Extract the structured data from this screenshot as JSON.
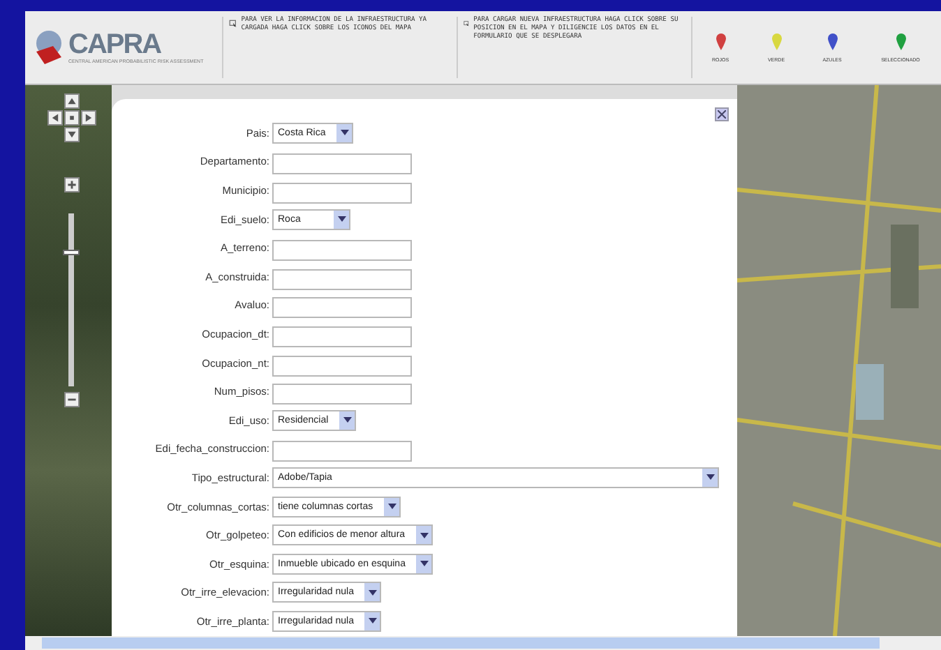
{
  "header": {
    "logo": {
      "name": "CAPRA",
      "subtitle": "CENTRAL AMERICAN PROBABILISTIC RISK ASSESSMENT"
    },
    "instructions": [
      {
        "text": "PARA VER LA INFORMACION DE LA INFRAESTRUCTURA YA CARGADA HAGA CLICK SOBRE LOS ICONOS DEL MAPA"
      },
      {
        "text": "PARA CARGAR NUEVA INFRAESTRUCTURA HAGA CLICK SOBRE SU POSICION EN EL MAPA Y DILIGENCIE LOS DATOS EN EL FORMULARIO QUE SE DESPLEGARA"
      }
    ],
    "legend": [
      {
        "label": "ROJOS",
        "color": "#d04040"
      },
      {
        "label": "VERDE",
        "color": "#d8d840"
      },
      {
        "label": "AZULES",
        "color": "#4050c8"
      },
      {
        "label": "SELECCIONADO",
        "color": "#20a040"
      }
    ]
  },
  "map": {
    "zoom_slider": {
      "level": 0.78
    }
  },
  "form": {
    "fields": [
      {
        "label": "Pais:",
        "kind": "select",
        "value": "Costa Rica"
      },
      {
        "label": "Departamento:",
        "kind": "text"
      },
      {
        "label": "Municipio:",
        "kind": "text"
      },
      {
        "label": "Edi_suelo:",
        "kind": "select",
        "value": "Roca"
      },
      {
        "label": "A_terreno:",
        "kind": "text"
      },
      {
        "label": "A_construida:",
        "kind": "text"
      },
      {
        "label": "Avaluo:",
        "kind": "text"
      },
      {
        "label": "Ocupacion_dt:",
        "kind": "text"
      },
      {
        "label": "Ocupacion_nt:",
        "kind": "text"
      },
      {
        "label": "Num_pisos:",
        "kind": "text"
      },
      {
        "label": "Edi_uso:",
        "kind": "select",
        "value": "Residencial"
      },
      {
        "label": "Edi_fecha_construccion:",
        "kind": "text"
      },
      {
        "label": "Tipo_estructural:",
        "kind": "select",
        "value": "Adobe/Tapia"
      },
      {
        "label": "Otr_columnas_cortas:",
        "kind": "select",
        "value": "tiene columnas cortas"
      },
      {
        "label": "Otr_golpeteo:",
        "kind": "select",
        "value": "Con edificios de menor altura"
      },
      {
        "label": "Otr_esquina:",
        "kind": "select",
        "value": "Inmueble ubicado en esquina"
      },
      {
        "label": "Otr_irre_elevacion:",
        "kind": "select",
        "value": "Irregularidad nula"
      },
      {
        "label": "Otr_irre_planta:",
        "kind": "select",
        "value": "Irregularidad nula"
      }
    ]
  }
}
